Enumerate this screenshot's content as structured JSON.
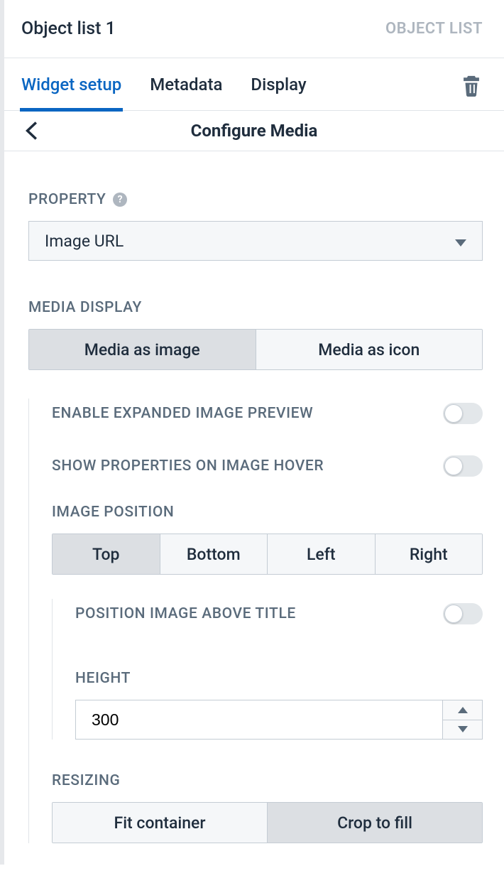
{
  "header": {
    "title": "Object list 1",
    "type_label": "OBJECT LIST"
  },
  "tabs": [
    {
      "label": "Widget setup",
      "active": true
    },
    {
      "label": "Metadata",
      "active": false
    },
    {
      "label": "Display",
      "active": false
    }
  ],
  "subheader": {
    "title": "Configure Media"
  },
  "property": {
    "label": "PROPERTY",
    "selected": "Image URL"
  },
  "media_display": {
    "label": "MEDIA DISPLAY",
    "options": [
      "Media as image",
      "Media as icon"
    ],
    "selected_index": 0
  },
  "toggles": {
    "expanded_preview": {
      "label": "ENABLE EXPANDED IMAGE PREVIEW",
      "enabled": false
    },
    "hover_properties": {
      "label": "SHOW PROPERTIES ON IMAGE HOVER",
      "enabled": false
    },
    "above_title": {
      "label": "POSITION IMAGE ABOVE TITLE",
      "enabled": false
    }
  },
  "image_position": {
    "label": "IMAGE POSITION",
    "options": [
      "Top",
      "Bottom",
      "Left",
      "Right"
    ],
    "selected_index": 0
  },
  "height": {
    "label": "HEIGHT",
    "value": "300"
  },
  "resizing": {
    "label": "RESIZING",
    "options": [
      "Fit container",
      "Crop to fill"
    ],
    "selected_index": 1
  }
}
